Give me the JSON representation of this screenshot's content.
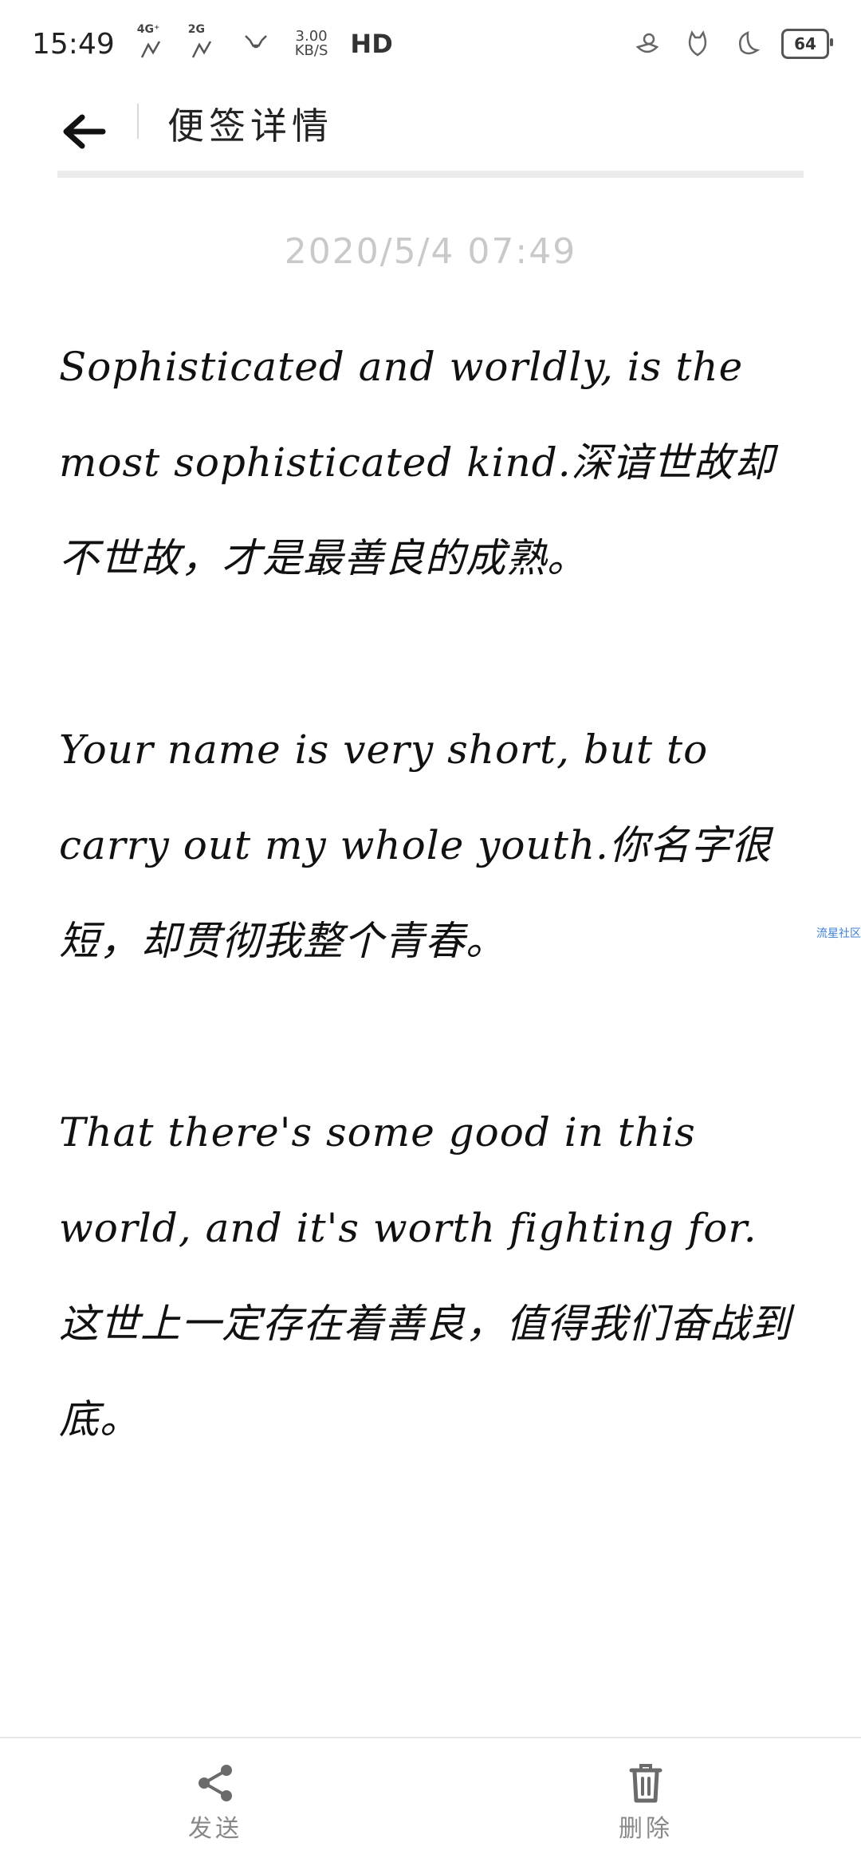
{
  "status_bar": {
    "time": "15:49",
    "net_4g": "4G⁺",
    "net_2g": "2G",
    "speed_value": "3.00",
    "speed_unit": "KB/S",
    "hd_label": "HD",
    "battery": "64"
  },
  "header": {
    "title": "便签详情"
  },
  "note": {
    "date": "2020/5/4 07:49",
    "paragraphs": [
      "Sophisticated and worldly, is the most sophisticated kind.深谙世故却不世故，才是最善良的成熟。",
      "Your name is very short, but to carry out my whole youth.你名字很短，却贯彻我整个青春。",
      "That there's some good in this world, and it's worth fighting for. 这世上一定存在着善良，值得我们奋战到底。"
    ]
  },
  "watermark": "流星社区",
  "bottom_bar": {
    "send_label": "发送",
    "delete_label": "删除"
  }
}
